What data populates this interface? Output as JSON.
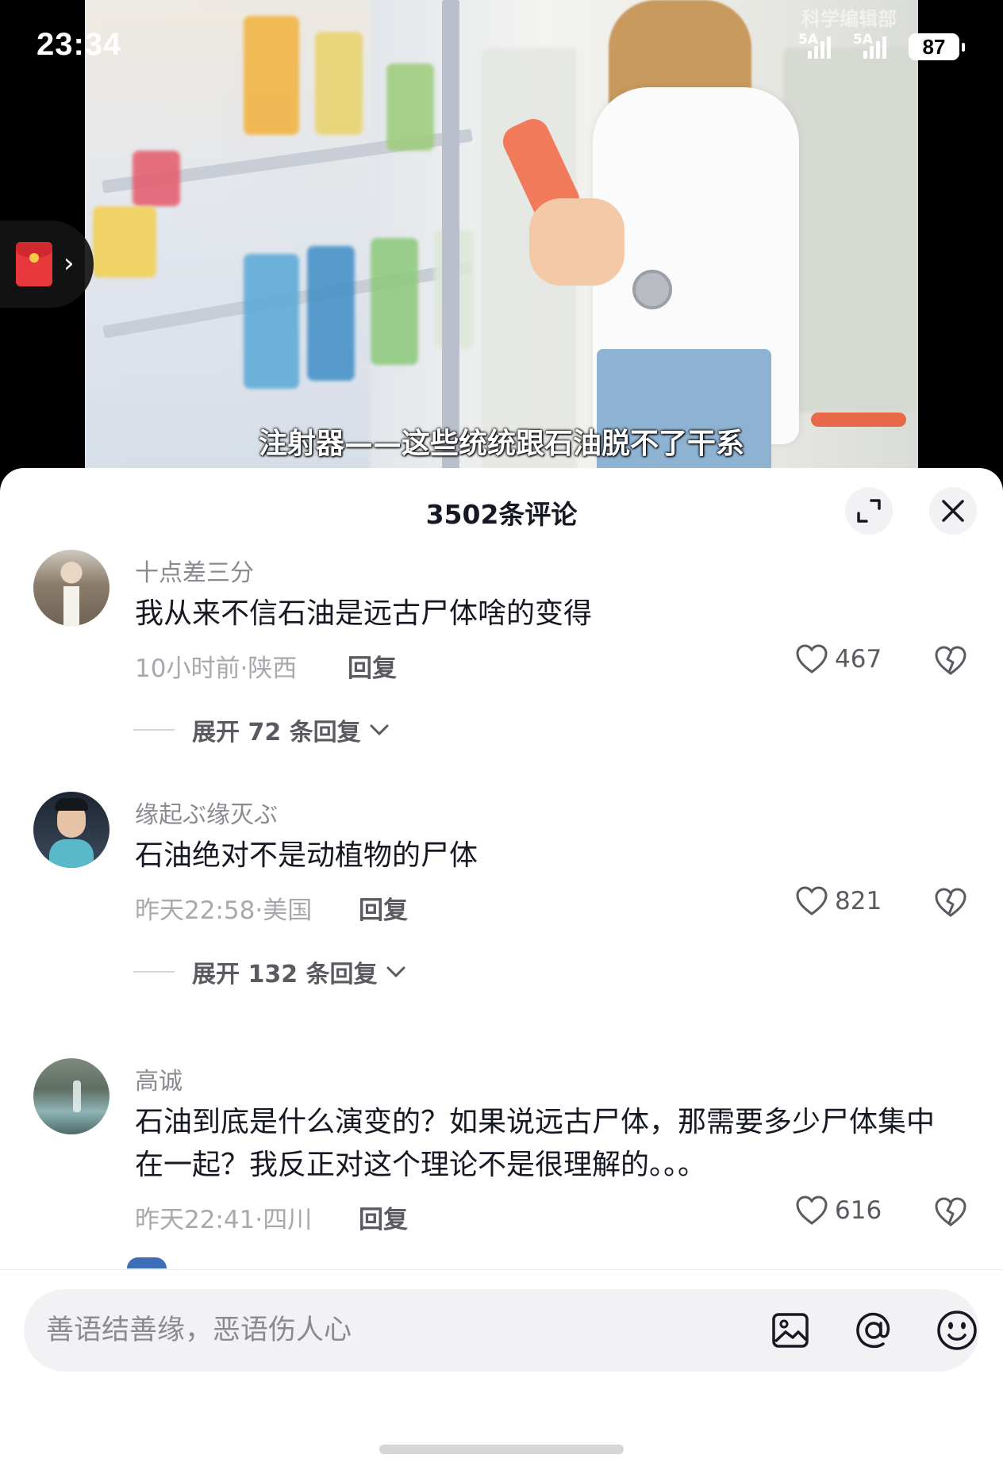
{
  "status": {
    "time": "23:34",
    "network1": "5A",
    "network2": "5A",
    "battery": "87"
  },
  "video": {
    "watermark": "科学编辑部",
    "subtitle": "注射器——这些统统跟石油脱不了干系"
  },
  "sheet": {
    "title": "3502条评论"
  },
  "comments": [
    {
      "username": "十点差三分",
      "text": "我从来不信石油是远古尸体啥的变得",
      "meta": "10小时前·陕西",
      "reply_label": "回复",
      "likes": "467",
      "expand_label": "展开 72 条回复"
    },
    {
      "username": "缘起ぶ缘灭ぶ",
      "text": "石油绝对不是动植物的尸体",
      "meta": "昨天22:58·美国",
      "reply_label": "回复",
      "likes": "821",
      "expand_label": "展开 132 条回复"
    },
    {
      "username": "高诚",
      "text": "石油到底是什么演变的？如果说远古尸体，那需要多少尸体集中在一起？我反正对这个理论不是很理解的。。。",
      "meta": "昨天22:41·四川",
      "reply_label": "回复",
      "likes": "616"
    }
  ],
  "input": {
    "placeholder": "善语结善缘，恶语伤人心"
  },
  "icons": [
    "red-packet-icon",
    "chevron-right-icon",
    "expand-icon",
    "close-icon",
    "heart-icon",
    "dislike-icon",
    "chevron-down-icon",
    "image-icon",
    "at-icon",
    "emoji-icon"
  ]
}
